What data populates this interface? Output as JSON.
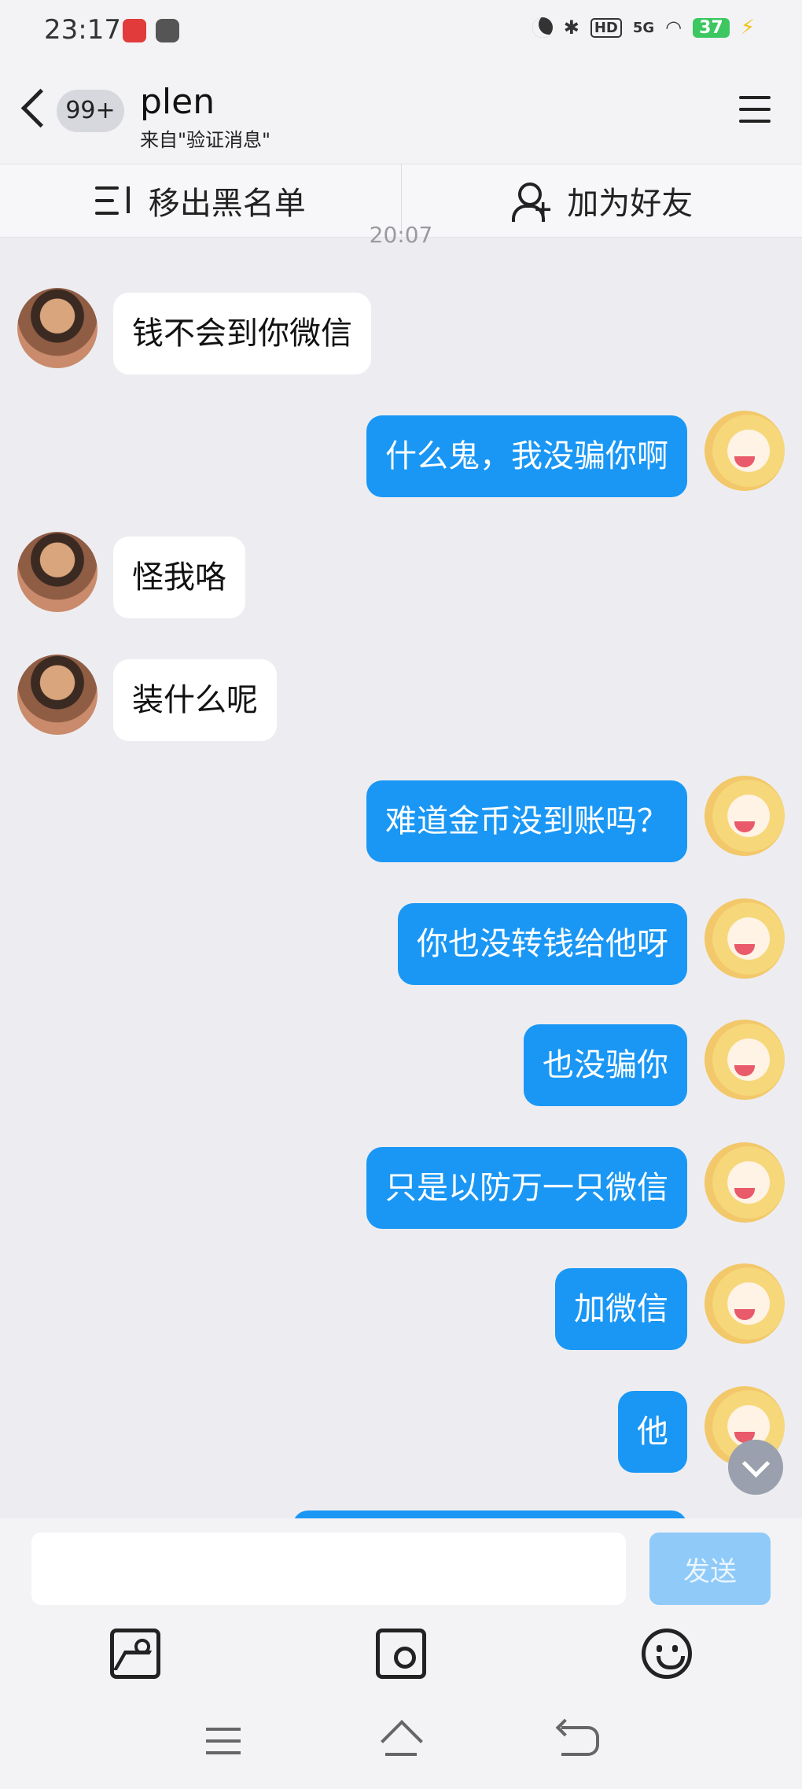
{
  "status_bar": {
    "time": "23:17",
    "network": "5G",
    "hd": "HD",
    "battery": "37"
  },
  "header": {
    "unread_badge": "99+",
    "contact_name": "plen",
    "source": "来自\"验证消息\""
  },
  "actions": {
    "remove_blacklist": "移出黑名单",
    "add_friend": "加为好友"
  },
  "timestamp": "20:07",
  "messages": [
    {
      "from": "other",
      "text": "钱不会到你微信"
    },
    {
      "from": "me",
      "text": "什么鬼，我没骗你啊"
    },
    {
      "from": "other",
      "text": "怪我咯"
    },
    {
      "from": "other",
      "text": "装什么呢"
    },
    {
      "from": "me",
      "text": "难道金币没到账吗？"
    },
    {
      "from": "me",
      "text": "你也没转钱给他呀"
    },
    {
      "from": "me",
      "text": "也没骗你"
    },
    {
      "from": "me",
      "text": "只是以防万一只微信"
    },
    {
      "from": "me",
      "text": "加微信"
    },
    {
      "from": "me",
      "text": "他"
    }
  ],
  "composer": {
    "input_value": "",
    "send_label": "发送"
  },
  "colors": {
    "outgoing_bubble": "#1a97f5",
    "incoming_bubble": "#ffffff",
    "background": "#ededf1",
    "send_disabled": "#8fcaf8"
  }
}
